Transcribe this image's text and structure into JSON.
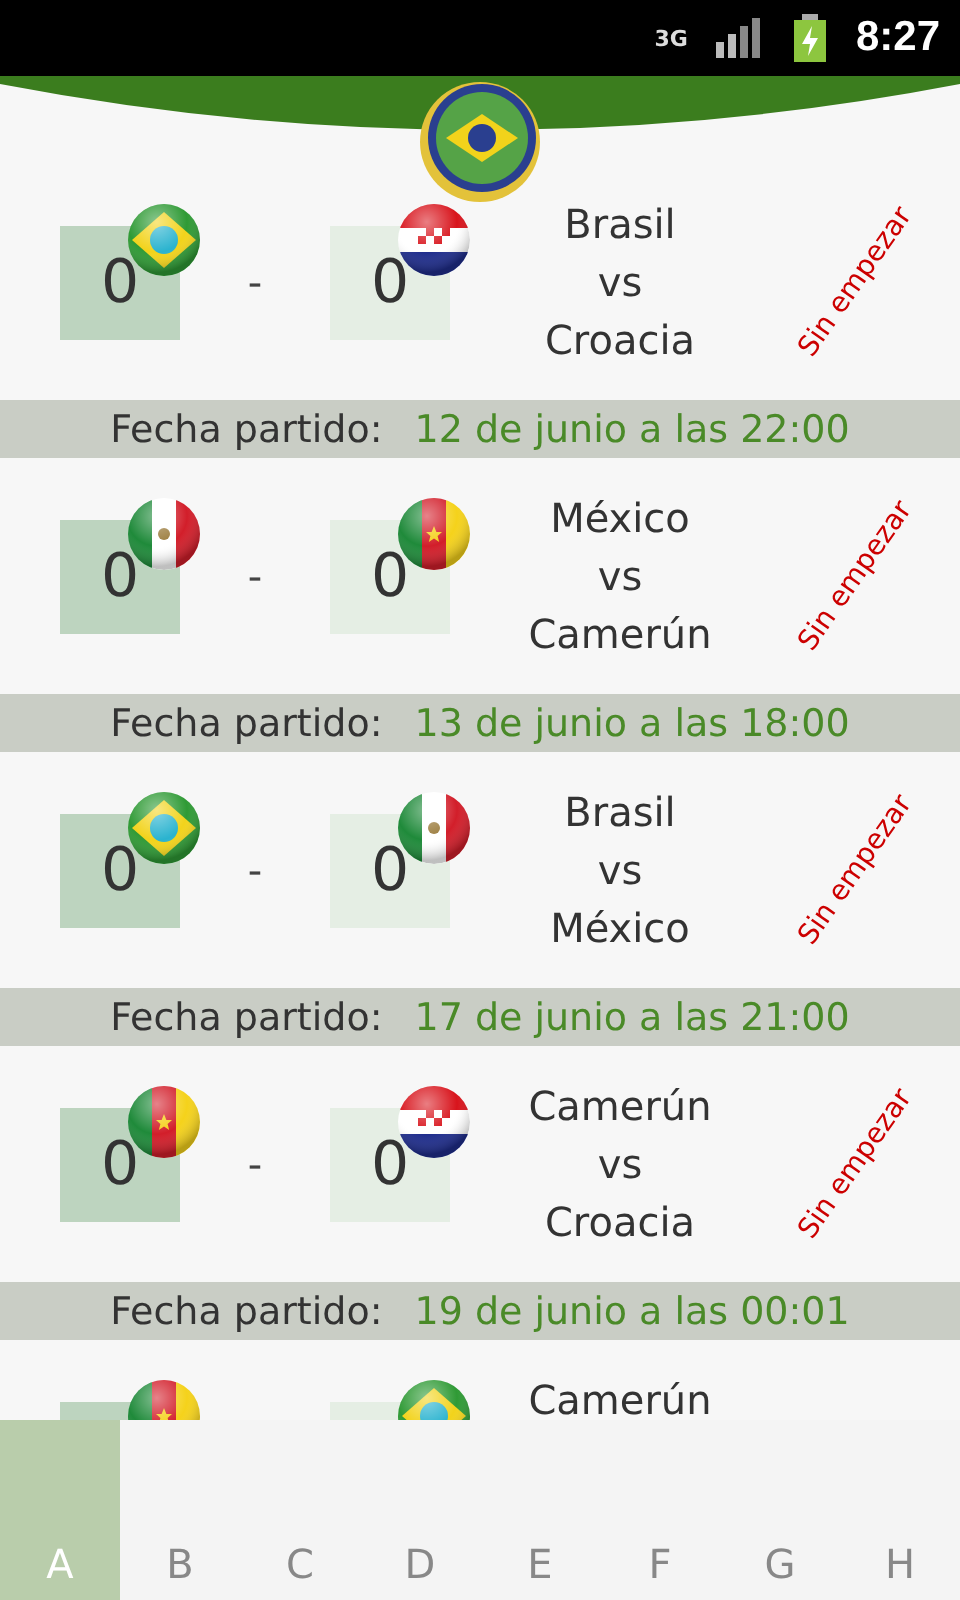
{
  "status_bar": {
    "network": "3G",
    "time": "8:27"
  },
  "matches": [
    {
      "home": {
        "kind": "brazil",
        "score": "0"
      },
      "separator": "-",
      "away": {
        "kind": "croatia",
        "score": "0"
      },
      "teams": [
        "Brasil",
        "vs",
        "Croacia"
      ],
      "status": "Sin empezar",
      "date_label": "Fecha partido:",
      "date": "12 de junio a las 22:00"
    },
    {
      "home": {
        "kind": "mexico",
        "score": "0"
      },
      "separator": "-",
      "away": {
        "kind": "cameroon",
        "score": "0"
      },
      "teams": [
        "México",
        "vs",
        "Camerún"
      ],
      "status": "Sin empezar",
      "date_label": "Fecha partido:",
      "date": "13 de junio a las 18:00"
    },
    {
      "home": {
        "kind": "brazil",
        "score": "0"
      },
      "separator": "-",
      "away": {
        "kind": "mexico",
        "score": "0"
      },
      "teams": [
        "Brasil",
        "vs",
        "México"
      ],
      "status": "Sin empezar",
      "date_label": "Fecha partido:",
      "date": "17 de junio a las 21:00"
    },
    {
      "home": {
        "kind": "cameroon",
        "score": "0"
      },
      "separator": "-",
      "away": {
        "kind": "croatia",
        "score": "0"
      },
      "teams": [
        "Camerún",
        "vs",
        "Croacia"
      ],
      "status": "Sin empezar",
      "date_label": "Fecha partido:",
      "date": "19 de junio a las 00:01"
    },
    {
      "home": {
        "kind": "cameroon"
      },
      "away": {
        "kind": "brazil"
      },
      "teams": [
        "Camerún"
      ]
    }
  ],
  "tabs": [
    {
      "label": "A",
      "selected": true
    },
    {
      "label": "B",
      "selected": false
    },
    {
      "label": "C",
      "selected": false
    },
    {
      "label": "D",
      "selected": false
    },
    {
      "label": "E",
      "selected": false
    },
    {
      "label": "F",
      "selected": false
    },
    {
      "label": "G",
      "selected": false
    },
    {
      "label": "H",
      "selected": false
    }
  ]
}
